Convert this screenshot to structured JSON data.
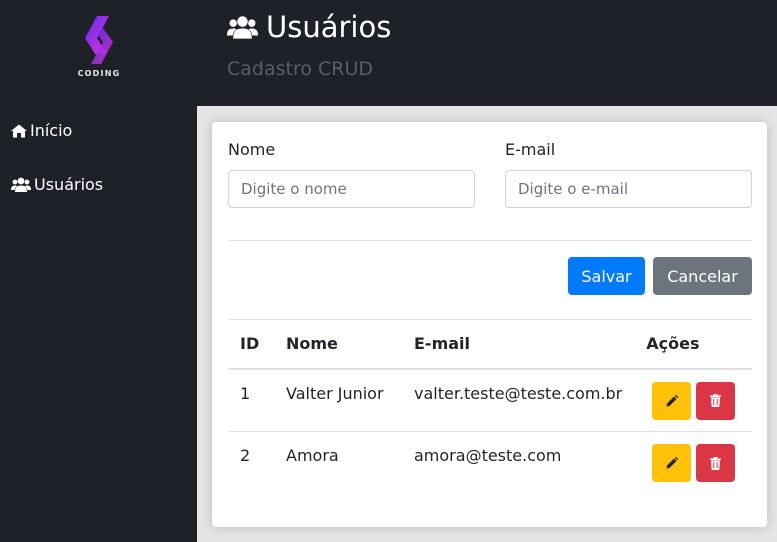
{
  "brand": {
    "logo_text": "CODING"
  },
  "sidebar": {
    "items": [
      {
        "label": "Início",
        "icon": "home-icon"
      },
      {
        "label": "Usuários",
        "icon": "users-icon"
      }
    ]
  },
  "header": {
    "title": "Usuários",
    "subtitle": "Cadastro CRUD",
    "icon": "users-icon"
  },
  "form": {
    "name_label": "Nome",
    "name_placeholder": "Digite o nome",
    "name_value": "",
    "email_label": "E-mail",
    "email_placeholder": "Digite o e-mail",
    "email_value": "",
    "save_label": "Salvar",
    "cancel_label": "Cancelar"
  },
  "table": {
    "headers": {
      "id": "ID",
      "name": "Nome",
      "email": "E-mail",
      "actions": "Ações"
    },
    "rows": [
      {
        "id": "1",
        "name": "Valter Junior",
        "email": "valter.teste@teste.com.br"
      },
      {
        "id": "2",
        "name": "Amora",
        "email": "amora@teste.com"
      }
    ]
  },
  "colors": {
    "sidebar_bg": "#1f2129",
    "content_bg": "#e5e5e5",
    "primary": "#007bff",
    "secondary": "#6c757d",
    "warning": "#ffc107",
    "danger": "#dc3545",
    "logo_gradient": [
      "#6a2cf0",
      "#e02ccf"
    ]
  }
}
